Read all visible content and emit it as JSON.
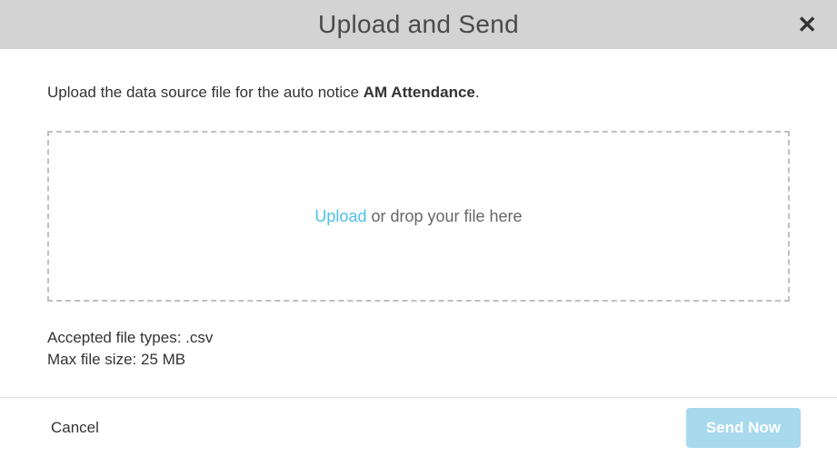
{
  "header": {
    "title": "Upload and Send"
  },
  "body": {
    "instruction_prefix": "Upload the data source file for the auto notice ",
    "instruction_bold": "AM Attendance",
    "instruction_suffix": ".",
    "dropzone": {
      "upload_link": "Upload",
      "rest_text": " or drop your file here"
    },
    "accepted_types_label": "Accepted file types: ",
    "accepted_types_value": ".csv",
    "max_size_label": "Max file size: ",
    "max_size_value": "25 MB"
  },
  "footer": {
    "cancel_label": "Cancel",
    "send_label": "Send Now"
  }
}
